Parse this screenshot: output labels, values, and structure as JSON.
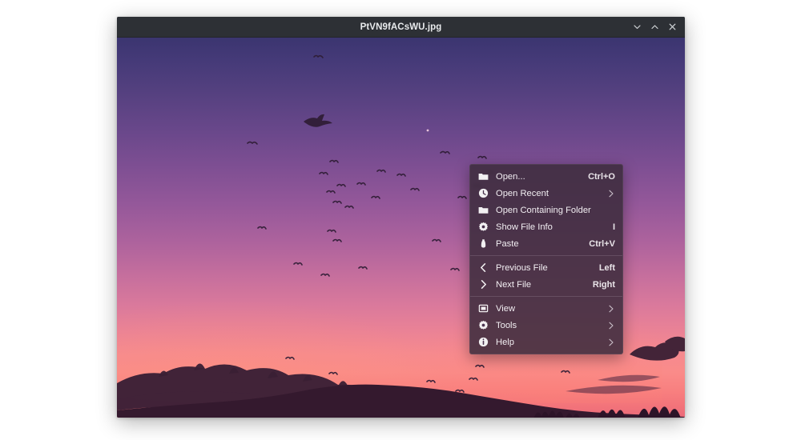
{
  "window": {
    "title": "PtVN9fACsWU.jpg",
    "controls": [
      {
        "name": "minimize-button",
        "icon": "chevron-down-icon",
        "label": "Minimize"
      },
      {
        "name": "maximize-button",
        "icon": "chevron-up-icon",
        "label": "Maximize"
      },
      {
        "name": "close-button",
        "icon": "close-icon",
        "label": "Close"
      }
    ]
  },
  "image": {
    "description": "Sunset sky with flock of birds over silhouetted mountain ridge and clouds",
    "colors": {
      "sky_top": "#3b3570",
      "sky_mid": "#95589a",
      "sky_low": "#f68a8f",
      "sky_bottom": "#e9697a",
      "silhouette": "#3a2036"
    }
  },
  "context_menu": {
    "background": "#3e2c3e",
    "groups": [
      {
        "items": [
          {
            "icon": "folder-open-icon",
            "label": "Open...",
            "accel": "Ctrl+O",
            "submenu": false
          },
          {
            "icon": "clock-icon",
            "label": "Open Recent",
            "accel": "",
            "submenu": true
          },
          {
            "icon": "folder-icon",
            "label": "Open Containing Folder",
            "accel": "",
            "submenu": false
          },
          {
            "icon": "gear-icon",
            "label": "Show File Info",
            "accel": "I",
            "submenu": false
          },
          {
            "icon": "paste-icon",
            "label": "Paste",
            "accel": "Ctrl+V",
            "submenu": false
          }
        ]
      },
      {
        "items": [
          {
            "icon": "chevron-left-icon",
            "label": "Previous File",
            "accel": "Left",
            "submenu": false
          },
          {
            "icon": "chevron-right-icon",
            "label": "Next File",
            "accel": "Right",
            "submenu": false
          }
        ]
      },
      {
        "items": [
          {
            "icon": "image-view-icon",
            "label": "View",
            "accel": "",
            "submenu": true
          },
          {
            "icon": "gear-icon",
            "label": "Tools",
            "accel": "",
            "submenu": true
          },
          {
            "icon": "info-icon",
            "label": "Help",
            "accel": "",
            "submenu": true
          }
        ]
      }
    ]
  }
}
